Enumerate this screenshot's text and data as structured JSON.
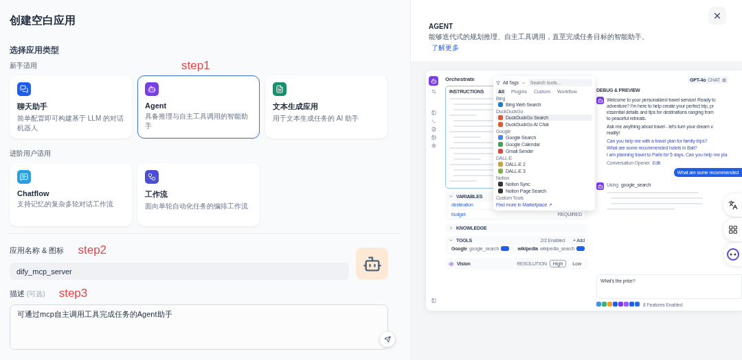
{
  "dialog": {
    "title": "创建空白应用",
    "section_title": "选择应用类型",
    "groups": [
      {
        "label": "新手适用",
        "annotation": "step1",
        "cards": [
          {
            "kind": "chat",
            "color": "#1f5ee8",
            "title": "聊天助手",
            "description": "简单配置即可构建基于 LLM 的对话机器人",
            "selected": false
          },
          {
            "kind": "agent",
            "color": "#7a3fe4",
            "title": "Agent",
            "description": "具备推理与自主工具调用的智能助手",
            "selected": true
          },
          {
            "kind": "text",
            "color": "#1a8f6f",
            "title": "文本生成应用",
            "description": "用于文本生成任务的 AI 助手",
            "selected": false
          }
        ]
      },
      {
        "label": "进阶用户适用",
        "cards": [
          {
            "kind": "chatflow",
            "color": "#2b9fe0",
            "title": "Chatflow",
            "description": "支持记忆的复杂多轮对话工作流",
            "selected": false
          },
          {
            "kind": "workflow",
            "color": "#4a4fd8",
            "title": "工作流",
            "description": "面向单轮自动化任务的编排工作流",
            "selected": false
          }
        ]
      }
    ],
    "name_field": {
      "label": "应用名称 & 图标",
      "annotation": "step2",
      "value": "dify_mcp_server"
    },
    "description_field": {
      "label": "描述",
      "hint": "(可选)",
      "annotation": "step3",
      "value": "可通过mcp自主调用工具完成任务的Agent助手"
    }
  },
  "preview": {
    "title": "AGENT",
    "description": "能够迭代式的规划推理、自主工具调用，直至完成任务目标的智能助手。",
    "link": "了解更多",
    "app": {
      "header": "Orchestrate",
      "instructions": "INSTRUCTIONS",
      "picker": {
        "filter": "All Tags",
        "placeholder": "Search tools...",
        "tabs": [
          {
            "label": "All",
            "selected": true
          },
          {
            "label": "Plugins",
            "selected": false
          },
          {
            "label": "Custom",
            "selected": false
          },
          {
            "label": "Workflow",
            "selected": false
          }
        ],
        "groups": [
          {
            "label": "Bing",
            "items": [
              {
                "label": "Bing Web Search",
                "color": "#1a7fd4",
                "selected": false
              }
            ]
          },
          {
            "label": "DuckDuckGo",
            "items": [
              {
                "label": "DuckDuckGo Search",
                "color": "#de5833",
                "selected": true
              },
              {
                "label": "DuckDuckGo AI Chat",
                "color": "#de5833",
                "selected": false
              }
            ]
          },
          {
            "label": "Google",
            "items": [
              {
                "label": "Google Search",
                "color": "#4285f4",
                "selected": false
              },
              {
                "label": "Google Calendar",
                "color": "#34a853",
                "selected": false
              },
              {
                "label": "Gmail Sender",
                "color": "#ea4335",
                "selected": false
              }
            ]
          },
          {
            "label": "DALL-E",
            "items": [
              {
                "label": "DALL-E 2",
                "color": "#c9a23a",
                "selected": false
              },
              {
                "label": "DALL-E 3",
                "color": "#7fb04a",
                "selected": false
              }
            ]
          },
          {
            "label": "Notion",
            "items": [
              {
                "label": "Notion Sync",
                "color": "#333333",
                "selected": false
              },
              {
                "label": "Notion Page Search",
                "color": "#333333",
                "selected": false
              }
            ]
          },
          {
            "label": "Custom Tools"
          }
        ],
        "footer": "Find more in Marketplace ↗"
      },
      "variables": {
        "label": "VARIABLES",
        "rows": [
          {
            "name": "destination"
          },
          {
            "name": "budget",
            "badge": "REQUIRED"
          }
        ]
      },
      "knowledge": "KNOWLEDGE",
      "tools": {
        "label": "TOOLS",
        "count": "2/2 Enabled",
        "add": "+ Add",
        "items": [
          {
            "name": "Google",
            "id": "google_search",
            "on": true
          },
          {
            "name": "wikipedia",
            "id": "wikipedia_search",
            "on": true
          }
        ]
      },
      "vision": {
        "label": "Vision",
        "setting": "RESOLUTION",
        "options": [
          {
            "label": "High",
            "selected": true
          },
          {
            "label": "Low",
            "selected": false
          }
        ]
      },
      "model": {
        "name": "GPT-4o",
        "mode": "CHAT"
      },
      "debug": {
        "title": "DEBUG & PREVIEW",
        "welcome": [
          "Welcome to your personalized travel service! Ready to",
          "adventure? I'm here to help create your perfect trip, pr",
          "essential details and tips for destinations ranging from",
          "to peaceful retreats."
        ],
        "ask": [
          "Ask me anything about travel - let's turn your dream v",
          "reality!"
        ],
        "suggestions": [
          "Can you help me with a travel plan for family trips?",
          "What are some recommended hotels in Bali?",
          "I am planning travel to Paris for 5 days. Can you help me pla"
        ],
        "opener": "Conversation Opener",
        "edit": "Edit",
        "user_message": "What are some recommended",
        "using": "Using",
        "tool": "google_search",
        "input": "What's the price?",
        "features": "8 Features Enabled"
      }
    }
  }
}
